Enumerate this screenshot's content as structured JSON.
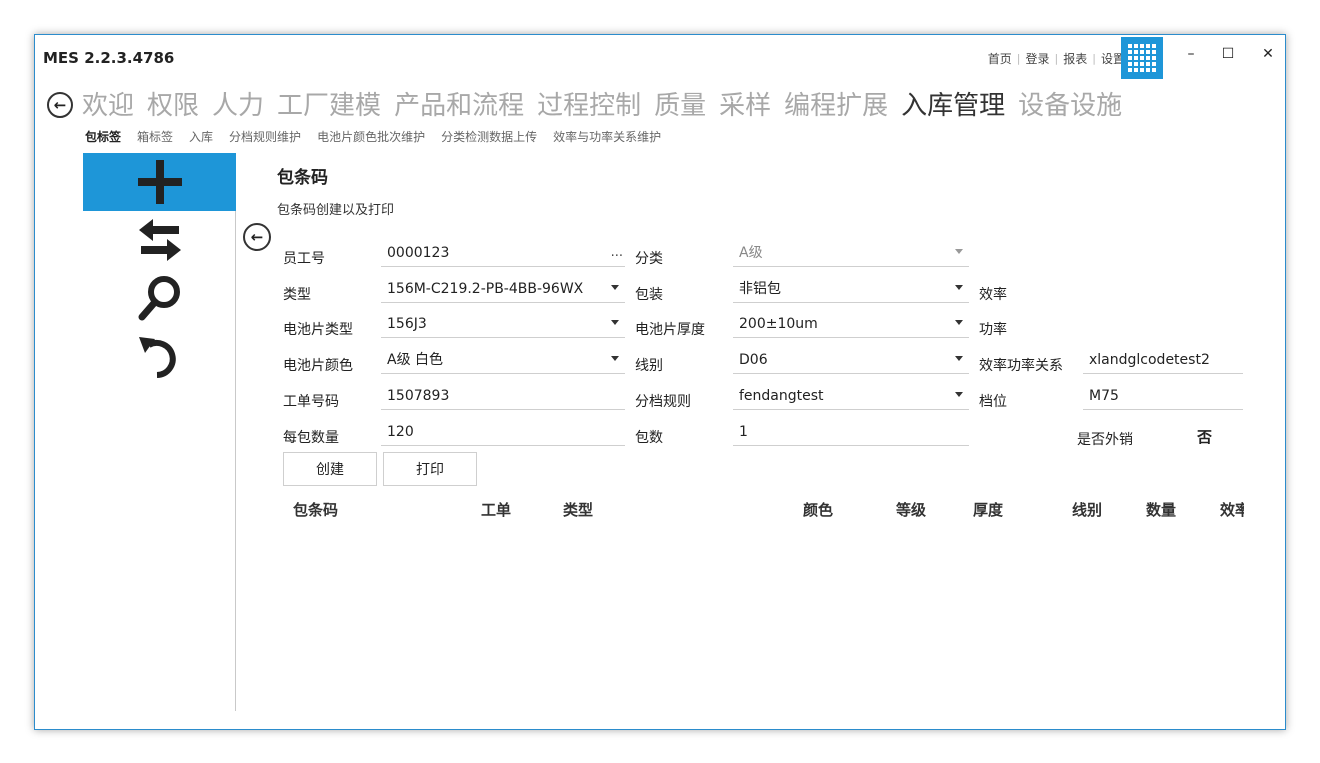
{
  "app": {
    "title": "MES 2.2.3.4786"
  },
  "top_links": [
    "首页",
    "登录",
    "报表",
    "设置"
  ],
  "window_controls": {
    "minimize": "–",
    "maximize": "☐",
    "close": "✕"
  },
  "main_nav": [
    "欢迎",
    "权限",
    "人力",
    "工厂建模",
    "产品和流程",
    "过程控制",
    "质量",
    "采样",
    "编程扩展",
    "入库管理",
    "设备设施"
  ],
  "main_nav_active": "入库管理",
  "sub_nav": [
    "包标签",
    "箱标签",
    "入库",
    "分档规则维护",
    "电池片颜色批次维护",
    "分类检测数据上传",
    "效率与功率关系维护"
  ],
  "section": {
    "title": "包条码",
    "subtitle": "包条码创建以及打印"
  },
  "form": {
    "employee_no": {
      "label": "员工号",
      "value": "0000123",
      "more": "..."
    },
    "category": {
      "label": "分类",
      "value": "A级"
    },
    "type": {
      "label": "类型",
      "value": "156M-C219.2-PB-4BB-96WX"
    },
    "packaging": {
      "label": "包装",
      "value": "非铝包"
    },
    "efficiency": {
      "label": "效率"
    },
    "cell_type": {
      "label": "电池片类型",
      "value": "156J3"
    },
    "cell_thickness": {
      "label": "电池片厚度",
      "value": "200±10um"
    },
    "power": {
      "label": "功率"
    },
    "cell_color": {
      "label": "电池片颜色",
      "value": "A级 白色"
    },
    "line": {
      "label": "线别",
      "value": "D06"
    },
    "eff_power_relation": {
      "label": "效率功率关系",
      "value": "xlandglcodetest2"
    },
    "work_order": {
      "label": "工单号码",
      "value": "1507893"
    },
    "grading_rule": {
      "label": "分档规则",
      "value": "fendangtest"
    },
    "grade": {
      "label": "档位",
      "value": "M75"
    },
    "qty_per_pack": {
      "label": "每包数量",
      "value": "120"
    },
    "pack_count": {
      "label": "包数",
      "value": "1"
    },
    "export": {
      "label": "是否外销",
      "value": "否"
    }
  },
  "buttons": {
    "create": "创建",
    "print": "打印"
  },
  "table": {
    "columns": [
      "包条码",
      "工单",
      "类型",
      "颜色",
      "等级",
      "厚度",
      "线别",
      "数量",
      "效率"
    ]
  },
  "colors": {
    "accent": "#1e96d8",
    "border": "#2b8ccc"
  },
  "icons": {
    "add": "plus-icon",
    "transfer": "swap-arrows-icon",
    "search": "search-icon",
    "undo": "undo-icon"
  }
}
